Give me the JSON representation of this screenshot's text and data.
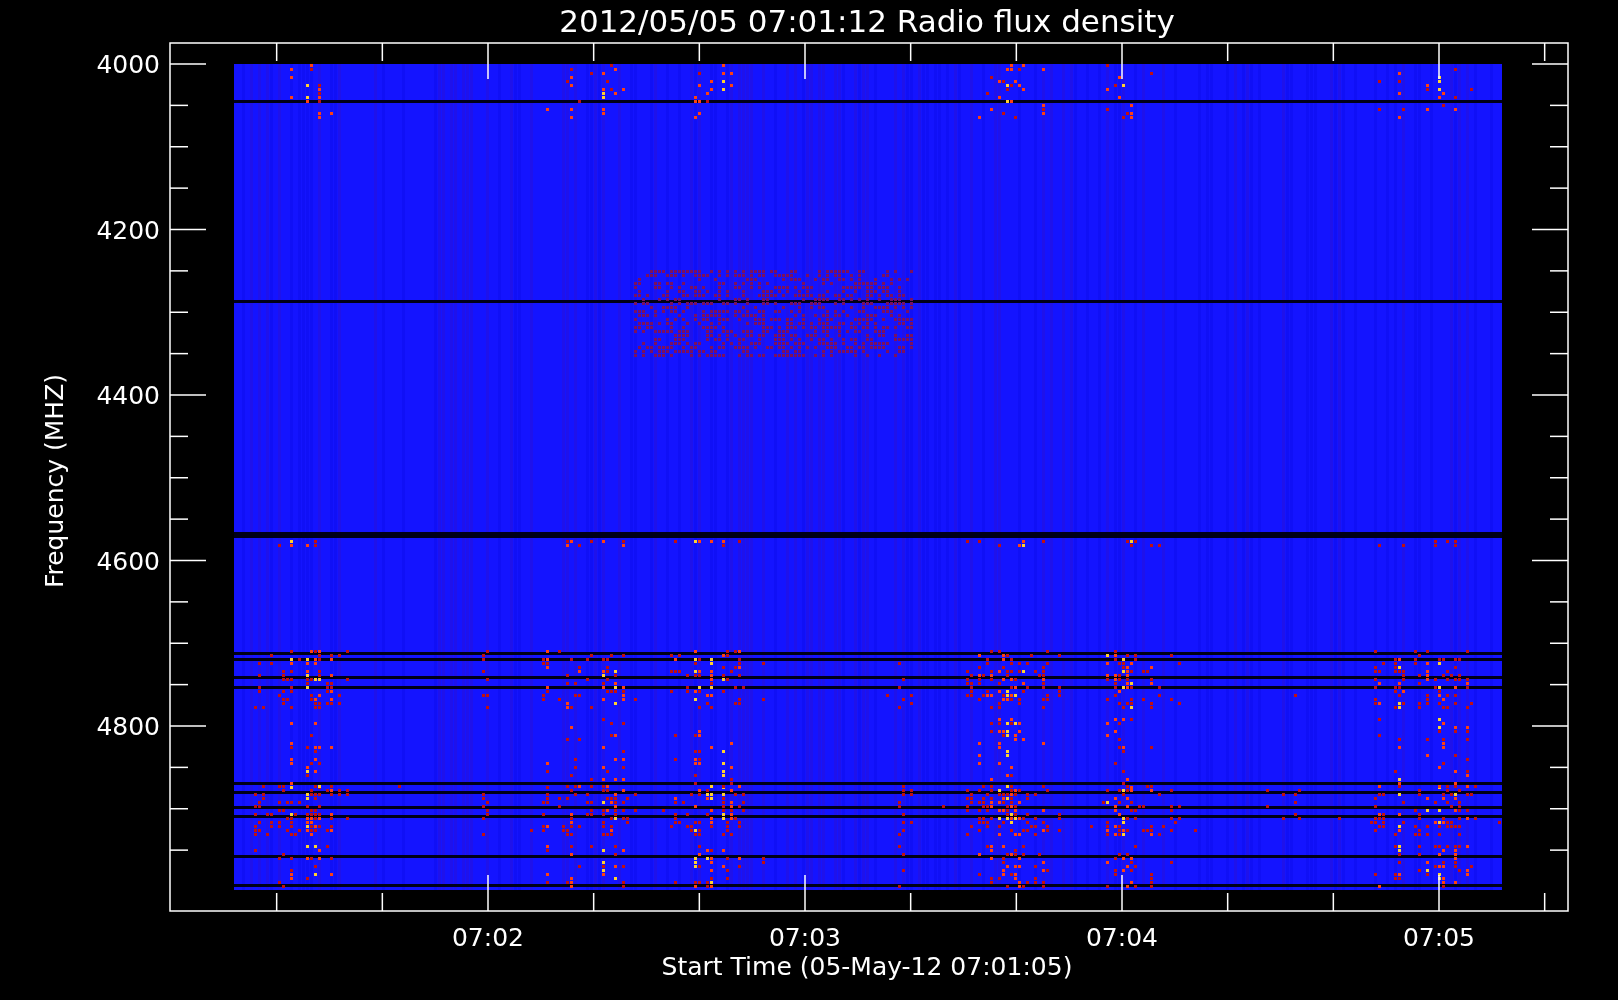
{
  "title": "2012/05/05 07:01:12 Radio flux density",
  "y_axis": {
    "label": "Frequency (MHZ)",
    "tick_labels": [
      "4000",
      "4200",
      "4400",
      "4600",
      "4800"
    ]
  },
  "x_axis": {
    "label": "Start Time (05-May-12 07:01:05)",
    "tick_labels": [
      "07:02",
      "07:03",
      "07:04",
      "07:05"
    ]
  }
}
